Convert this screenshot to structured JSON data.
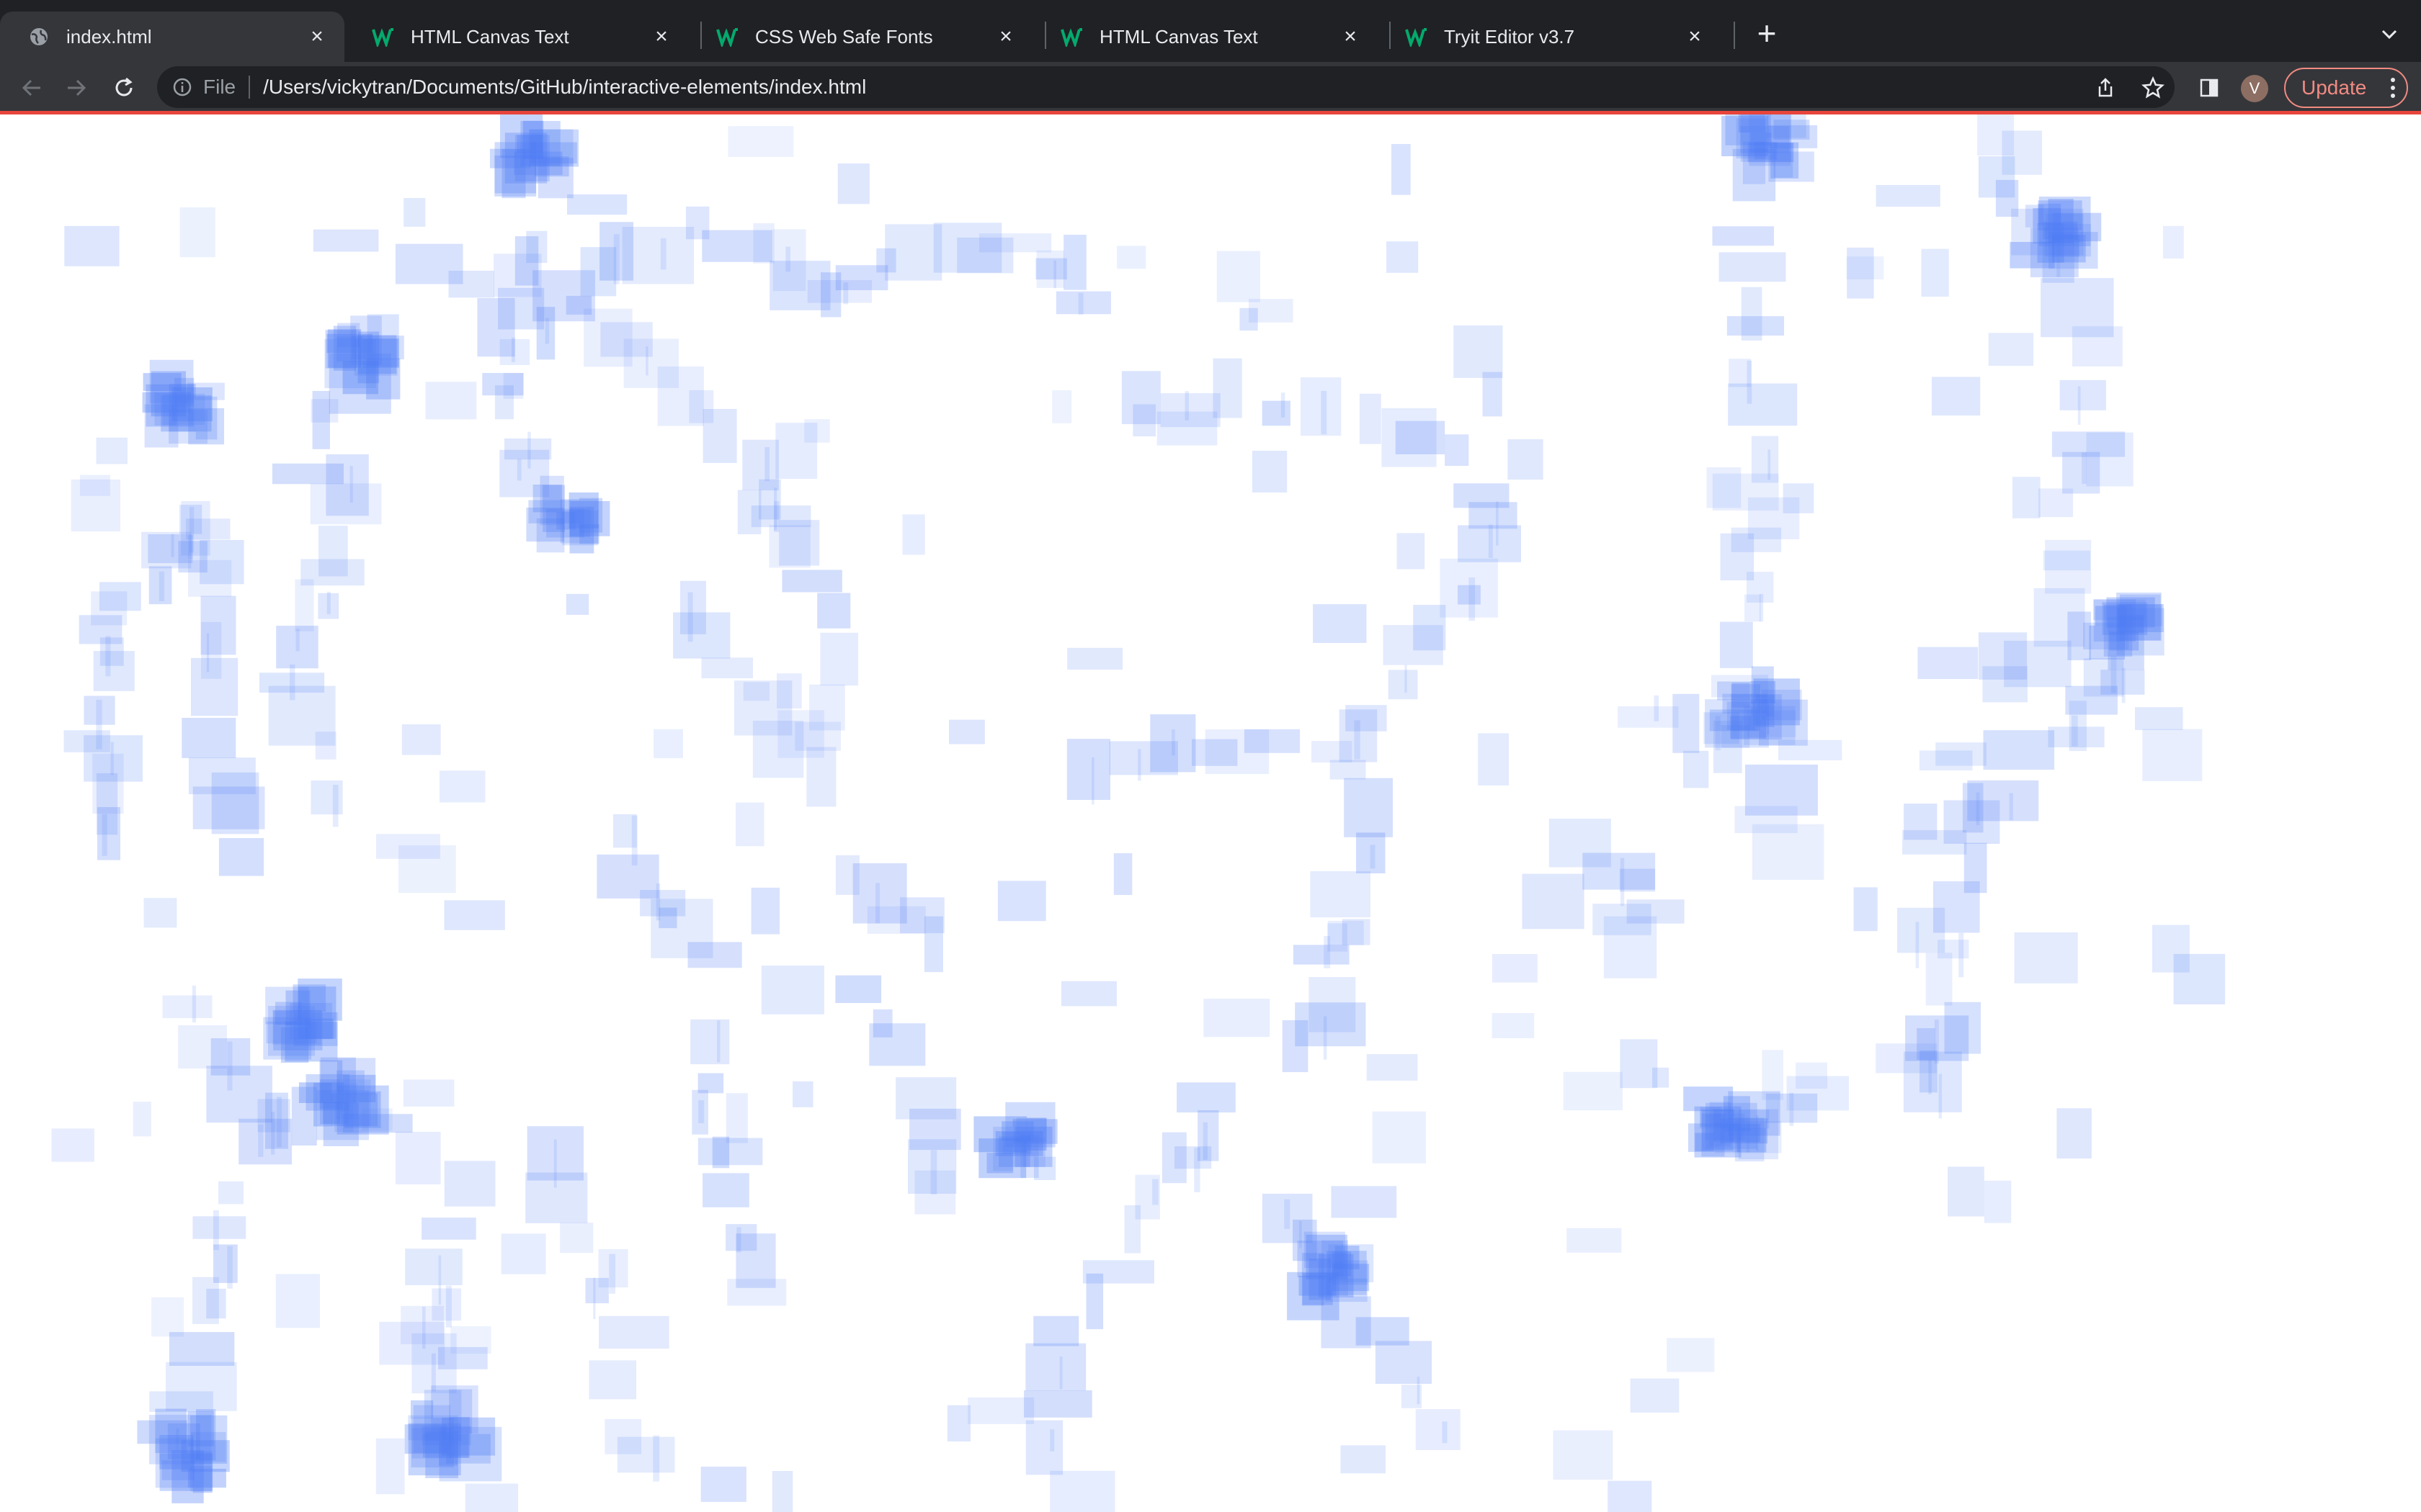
{
  "tabs": [
    {
      "title": "index.html",
      "favicon": "globe-icon",
      "active": true
    },
    {
      "title": "HTML Canvas Text",
      "favicon": "w3schools-icon",
      "active": false
    },
    {
      "title": "CSS Web Safe Fonts",
      "favicon": "w3schools-icon",
      "active": false
    },
    {
      "title": "HTML Canvas Text",
      "favicon": "w3schools-icon",
      "active": false
    },
    {
      "title": "Tryit Editor v3.7",
      "favicon": "w3schools-icon",
      "active": false
    }
  ],
  "address_bar": {
    "scheme_label": "File",
    "url": "/Users/vickytran/Documents/GitHub/interactive-elements/index.html"
  },
  "profile": {
    "initial": "V"
  },
  "update_button": {
    "label": "Update"
  },
  "colors": {
    "tabstrip": "#202124",
    "toolbar": "#35363a",
    "accent_update": "#f28b82",
    "canvas_rect": "#4f7df5",
    "w3schools_green": "#04aa6d"
  },
  "canvas": {
    "description_text": ""
  }
}
